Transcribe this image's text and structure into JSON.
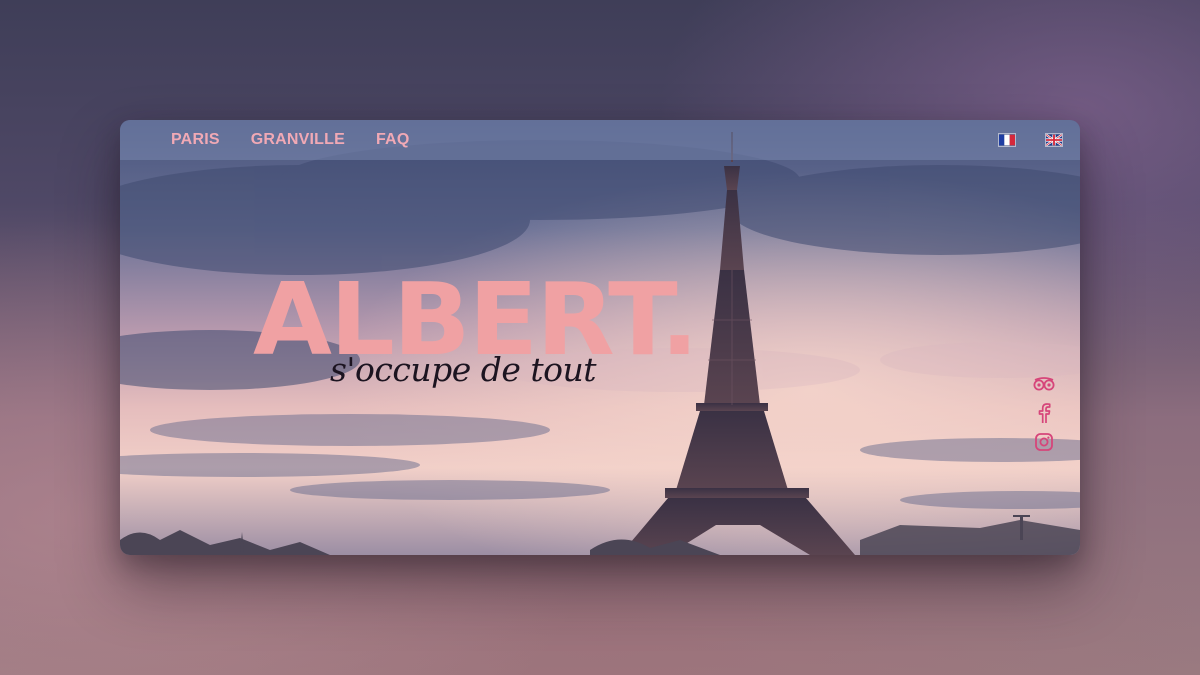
{
  "nav": {
    "links": [
      "PARIS",
      "GRANVILLE",
      "FAQ"
    ]
  },
  "languages": [
    {
      "code": "fr",
      "icon": "french-flag-icon"
    },
    {
      "code": "en",
      "icon": "uk-flag-icon"
    }
  ],
  "hero": {
    "brand": "ALBERT",
    "brand_dot": ".",
    "tagline": "s'occupe de tout"
  },
  "social": [
    {
      "icon": "tripadvisor-icon"
    },
    {
      "icon": "facebook-icon"
    },
    {
      "icon": "instagram-icon"
    }
  ],
  "colors": {
    "accent": "#f0a1a3",
    "nav_text": "#f1a9b5",
    "social_icon": "#d6457a",
    "tagline": "#1c1420"
  }
}
